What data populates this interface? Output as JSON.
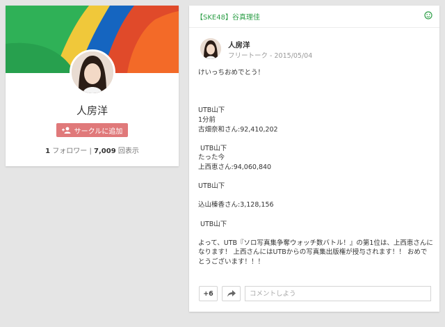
{
  "profile": {
    "name": "人房洋",
    "add_circle_label": "サークルに追加",
    "followers_count": "1",
    "followers_label": "フォロワー",
    "separator": "|",
    "views_count": "7,009",
    "views_label": "回表示"
  },
  "post": {
    "community": "【SKE48】谷真理佳",
    "author": "人房洋",
    "category": "フリートーク",
    "meta_separator": "-",
    "date": "2015/05/04",
    "lines": [
      "けいっちおめでとう！",
      "",
      "",
      "",
      "UTB山下",
      "1分前",
      "古畑奈和さん:92,410,202",
      "",
      " UTB山下",
      "たった今",
      "上西恵さん:94,060,840",
      "",
      "UTB山下",
      "",
      "込山榛香さん:3,128,156",
      "",
      " UTB山下",
      "",
      "よって、UTB『ソロ写真集争奪ウォッチ数バトル！』の第1位は、上西恵さんになります！ 上西さんにはUTBからの写真集出版権が授与されます！！ おめでとうございます！！！"
    ],
    "plus_one": "+6",
    "comment_placeholder": "コメントしよう"
  },
  "colors": {
    "community_green": "#2e9f48",
    "add_button_red": "#e0797a",
    "background": "#e5e5e5"
  },
  "icons": {
    "add_person": "add-person-icon",
    "community_status": "smile-icon",
    "share": "share-arrow-icon"
  }
}
